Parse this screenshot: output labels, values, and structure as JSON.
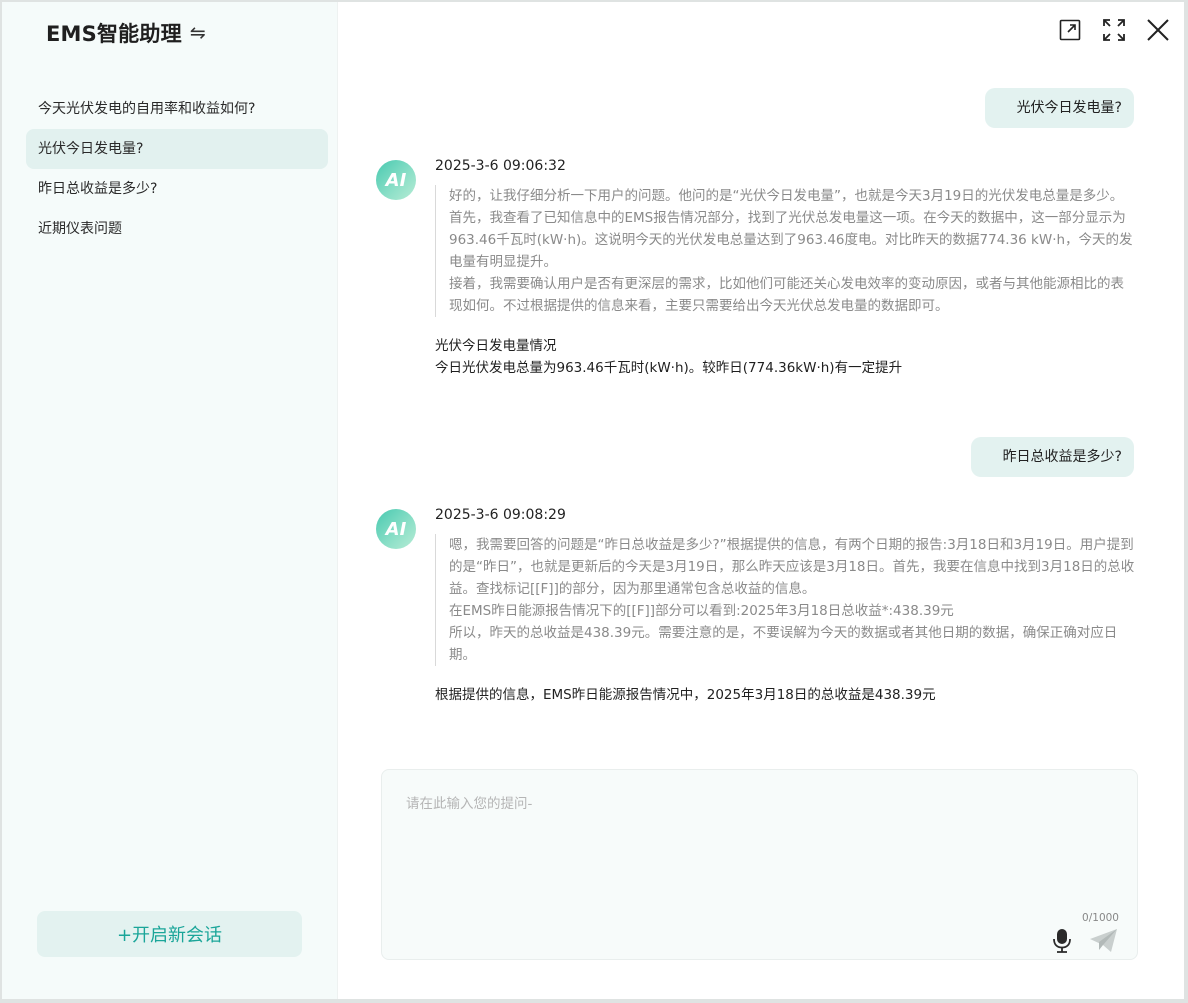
{
  "sidebar": {
    "brand": "EMS智能助理",
    "swap_glyph": "⇋",
    "history": [
      {
        "label": "今天光伏发电的自用率和收益如何?"
      },
      {
        "label": "光伏今日发电量?"
      },
      {
        "label": "昨日总收益是多少?"
      },
      {
        "label": "近期仪表问题"
      }
    ],
    "active_index": 1,
    "new_chat_label": "+开启新会话"
  },
  "window_controls": [
    "external-link-icon",
    "fullscreen-icon",
    "close-icon"
  ],
  "messages": [
    {
      "question": "光伏今日发电量?",
      "avatar": "AI",
      "time": "2025-3-6  09:06:32",
      "thinking": [
        "好的，让我仔细分析一下用户的问题。他问的是“光伏今日发电量”，也就是今天3月19日的光伏发电总量是多少。",
        "首先，我查看了已知信息中的EMS报告情况部分，找到了光伏总发电量这一项。在今天的数据中，这一部分显示为963.46千瓦时(kW·h)。这说明今天的光伏发电总量达到了963.46度电。对比昨天的数据774.36 kW·h，今天的发电量有明显提升。",
        "接着，我需要确认用户是否有更深层的需求，比如他们可能还关心发电效率的变动原因，或者与其他能源相比的表现如何。不过根据提供的信息来看，主要只需要给出今天光伏总发电量的数据即可。"
      ],
      "answer": [
        "光伏今日发电量情况",
        "今日光伏发电总量为963.46千瓦时(kW·h)。较昨日(774.36kW·h)有一定提升"
      ]
    },
    {
      "question": "昨日总收益是多少?",
      "avatar": "AI",
      "time": "2025-3-6  09:08:29",
      "thinking": [
        "嗯，我需要回答的问题是“昨日总收益是多少?”根据提供的信息，有两个日期的报告:3月18日和3月19日。用户提到的是“昨日”，也就是更新后的今天是3月19日，那么昨天应该是3月18日。首先，我要在信息中找到3月18日的总收益。查找标记[[F]]的部分，因为那里通常包含总收益的信息。",
        "在EMS昨日能源报告情况下的[[F]]部分可以看到:2025年3月18日总收益*:438.39元",
        "所以，昨天的总收益是438.39元。需要注意的是，不要误解为今天的数据或者其他日期的数据，确保正确对应日期。"
      ],
      "answer": [
        "根据提供的信息，EMS昨日能源报告情况中，2025年3月18日的总收益是438.39元"
      ]
    }
  ],
  "input": {
    "placeholder": "请在此输入您的提问-",
    "value": "",
    "counter": "0/1000",
    "mic_icon": "microphone-icon",
    "send_icon": "send-icon"
  },
  "colors": {
    "accent": "#1aa599",
    "sidebar_bg": "#f5fbfa",
    "bubble_bg": "#e3f2f0",
    "thinking_text": "#8a8a8a"
  }
}
